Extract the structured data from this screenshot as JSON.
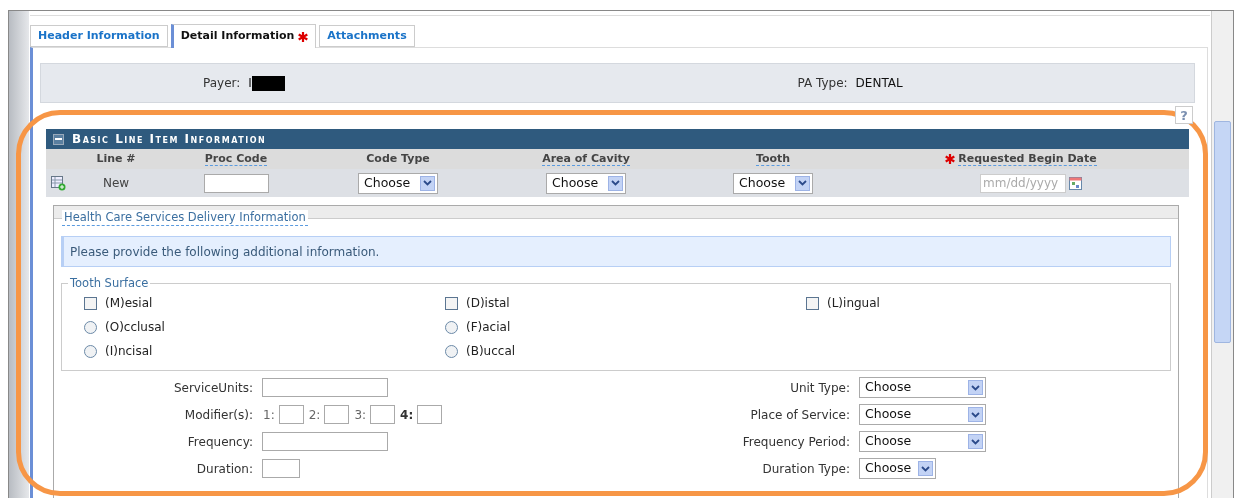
{
  "tabs": [
    {
      "label": "Header Information",
      "selected": false,
      "required": false
    },
    {
      "label": "Detail Information",
      "selected": true,
      "required": true
    },
    {
      "label": "Attachments",
      "selected": false,
      "required": false
    }
  ],
  "summary": [
    {
      "label": "Payer:",
      "value": "I",
      "redacted": true
    },
    {
      "label": "PA Type:",
      "value": "DENTAL",
      "redacted": false
    }
  ],
  "help_button": "?",
  "line_item": {
    "title": "Basic Line Item Information",
    "columns": [
      {
        "label": "Line #",
        "required": false,
        "hint": false
      },
      {
        "label": "Proc Code",
        "required": false,
        "hint": true
      },
      {
        "label": "Code Type",
        "required": false,
        "hint": false
      },
      {
        "label": "Area of Cavity",
        "required": false,
        "hint": true
      },
      {
        "label": "Tooth",
        "required": false,
        "hint": true
      },
      {
        "label": "Requested Begin Date",
        "required": true,
        "hint": true
      }
    ],
    "row": [
      {
        "kind": "text",
        "value": "New"
      },
      {
        "kind": "input"
      },
      {
        "kind": "select",
        "value": "Choose"
      },
      {
        "kind": "select",
        "value": "Choose"
      },
      {
        "kind": "select",
        "value": "Choose"
      },
      {
        "kind": "date",
        "placeholder": "mm/dd/yyyy"
      }
    ]
  },
  "delivery": {
    "legend": "Health Care Services Delivery Information",
    "message": "Please provide the following additional information.",
    "tooth_surface": {
      "legend": "Tooth Surface",
      "columns": [
        [
          {
            "label": "(M)esial",
            "kind": "checkbox",
            "checked": false
          },
          {
            "label": "(O)cclusal",
            "kind": "radio",
            "checked": false
          },
          {
            "label": "(I)ncisal",
            "kind": "radio",
            "checked": false
          }
        ],
        [
          {
            "label": "(D)istal",
            "kind": "checkbox",
            "checked": false
          },
          {
            "label": "(F)acial",
            "kind": "radio",
            "checked": false
          },
          {
            "label": "(B)uccal",
            "kind": "radio",
            "checked": false
          }
        ],
        [
          {
            "label": "(L)ingual",
            "kind": "checkbox",
            "checked": false
          }
        ]
      ]
    },
    "left_fields": [
      {
        "label": "ServiceUnits:",
        "kind": "wide"
      },
      {
        "label": "Modifier(s):",
        "kind": "modifiers",
        "parts": [
          {
            "label": "1:",
            "bold": false
          },
          {
            "label": "2:",
            "bold": false
          },
          {
            "label": "3:",
            "bold": false
          },
          {
            "label": "4:",
            "bold": true
          }
        ]
      },
      {
        "label": "Frequency:",
        "kind": "wide"
      },
      {
        "label": "Duration:",
        "kind": "short"
      }
    ],
    "right_fields": [
      {
        "label": "Unit Type:",
        "value": "Choose",
        "kind": "wide"
      },
      {
        "label": "Place of Service:",
        "value": "Choose",
        "kind": "wide"
      },
      {
        "label": "Frequency Period:",
        "value": "Choose",
        "kind": "wide"
      },
      {
        "label": "Duration Type:",
        "value": "Choose",
        "kind": "short"
      }
    ]
  }
}
